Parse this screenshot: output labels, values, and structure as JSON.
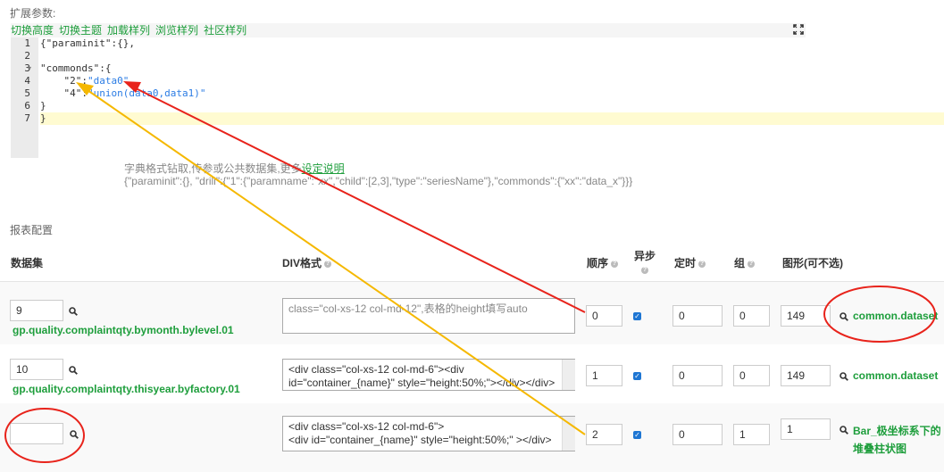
{
  "section_ext": "扩展参数:",
  "toolbar": [
    "切换高度",
    "切换主题",
    "加载样列",
    "浏览样列",
    "社区样列"
  ],
  "code_lines": [
    {
      "n": "1",
      "text": "{\"paraminit\":{},"
    },
    {
      "n": "2",
      "text": ""
    },
    {
      "n": "3",
      "text": "\"commonds\":{"
    },
    {
      "n": "4",
      "text": "    \"2\":\"data0\","
    },
    {
      "n": "5",
      "text": "    \"4\":\"union(data0,data1)\""
    },
    {
      "n": "6",
      "text": "}"
    },
    {
      "n": "7",
      "text": "}"
    }
  ],
  "hint_line1_prefix": "字典格式钻取,传参或公共数据集,更多",
  "hint_line1_link": "设定说明",
  "hint_line2": "{\"paraminit\":{}, \"drill\":{\"1\":{\"paramname\":\"xx\",\"child\":[2,3],\"type\":\"seriesName\"},\"commonds\":{\"xx\":\"data_x\"}}}",
  "section_report": "报表配置",
  "headers": {
    "dataset": "数据集",
    "div": "DIV格式",
    "order": "顺序",
    "async": "异步",
    "timer": "定时",
    "group": "组",
    "chart": "图形(可不选)"
  },
  "rows": [
    {
      "dataset_id": "9",
      "dataset_name": "gp.quality.complaintqty.bymonth.bylevel.01",
      "div": "",
      "div_placeholder": "class=\"col-xs-12 col-md-12\",表格的height填写auto",
      "order": "0",
      "async": true,
      "timer": "0",
      "group": "0",
      "chart_id": "149",
      "chart_name": "common.dataset"
    },
    {
      "dataset_id": "10",
      "dataset_name": "gp.quality.complaintqty.thisyear.byfactory.01",
      "div": "<div class=\"col-xs-12 col-md-6\"><div id=\"container_{name}\" style=\"height:50%;\"></div></div>",
      "div_placeholder": "",
      "order": "1",
      "async": true,
      "timer": "0",
      "group": "0",
      "chart_id": "149",
      "chart_name": "common.dataset"
    },
    {
      "dataset_id": "",
      "dataset_name": "",
      "div": "<div class=\"col-xs-12 col-md-6\">\n<div id=\"container_{name}\" style=\"height:50%;\" ></div>",
      "div_placeholder": "",
      "order": "2",
      "async": true,
      "timer": "0",
      "group": "1",
      "chart_id": "1",
      "chart_name": "Bar_极坐标系下的堆叠柱状图"
    }
  ],
  "colors": {
    "accent_green": "#1e9e3c",
    "red_annotation": "#e8231b",
    "yellow_annotation": "#f5b800",
    "checkbox_blue": "#1e76d3"
  }
}
